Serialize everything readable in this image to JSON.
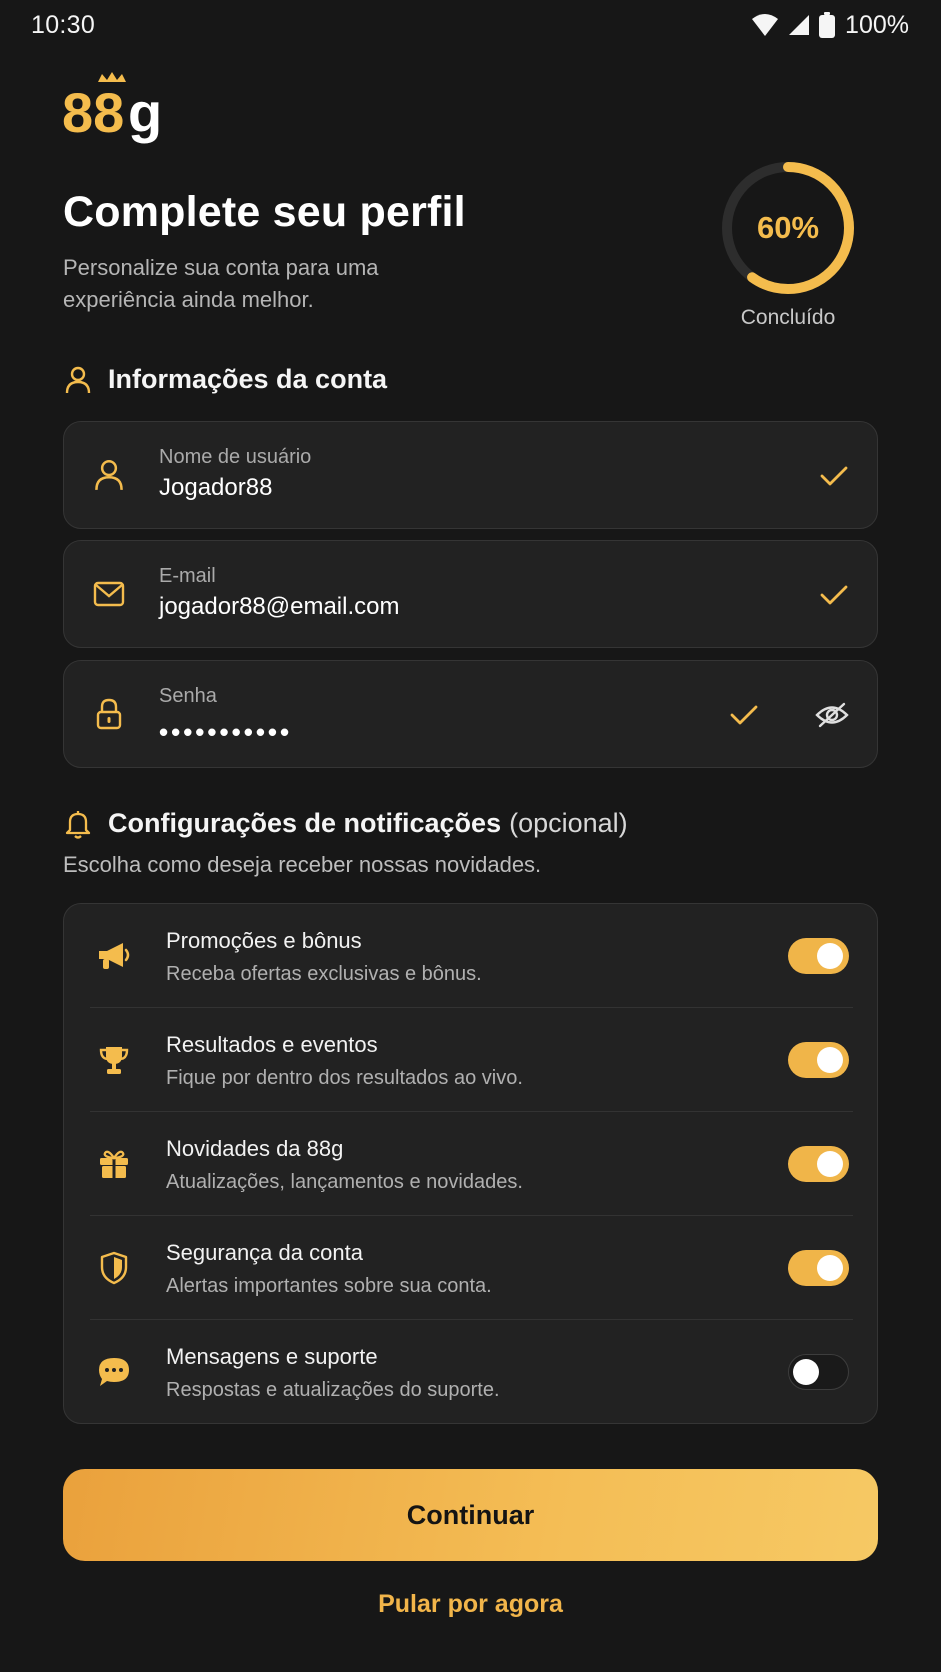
{
  "status_bar": {
    "time": "10:30",
    "battery": "100%",
    "icons": [
      "wifi-icon",
      "signal-icon",
      "battery-icon"
    ]
  },
  "logo": {
    "text": "88g"
  },
  "header": {
    "title": "Complete seu perfil",
    "subtitle": "Personalize sua conta para uma experiência ainda melhor.",
    "progress": {
      "value": 60,
      "label": "60%",
      "caption": "Concluído"
    }
  },
  "account_section": {
    "title": "Informações da conta",
    "icon": "user-icon",
    "fields": [
      {
        "label": "Nome de usuário",
        "value": "Jogador88",
        "icon": "user-icon",
        "valid": true
      },
      {
        "label": "E-mail",
        "value": "jogador88@email.com",
        "icon": "mail-icon",
        "valid": true
      },
      {
        "label": "Senha",
        "value": "•••••••••••",
        "icon": "lock-icon",
        "valid": true,
        "visibility_icon": "eye-off-icon"
      }
    ]
  },
  "notifications_section": {
    "title": "Configurações de notificações",
    "optional": "(opcional)",
    "description": "Escolha como deseja receber nossas novidades.",
    "icon": "bell-icon",
    "items": [
      {
        "title": "Promoções e bônus",
        "description": "Receba ofertas exclusivas e bônus.",
        "icon": "megaphone-icon",
        "enabled": true
      },
      {
        "title": "Resultados e eventos",
        "description": "Fique por dentro dos resultados ao vivo.",
        "icon": "trophy-icon",
        "enabled": true
      },
      {
        "title": "Novidades da 88g",
        "description": "Atualizações, lançamentos e novidades.",
        "icon": "gift-icon",
        "enabled": true
      },
      {
        "title": "Segurança da conta",
        "description": "Alertas importantes sobre sua conta.",
        "icon": "shield-icon",
        "enabled": true
      },
      {
        "title": "Mensagens e suporte",
        "description": "Respostas e atualizações do suporte.",
        "icon": "chat-icon",
        "enabled": false
      }
    ]
  },
  "actions": {
    "continue_label": "Continuar",
    "skip_label": "Pular por agora"
  },
  "colors": {
    "background": "#171717",
    "accent": "#f4bc4d",
    "card": "#222222",
    "toggle_on": "#f0b549"
  }
}
